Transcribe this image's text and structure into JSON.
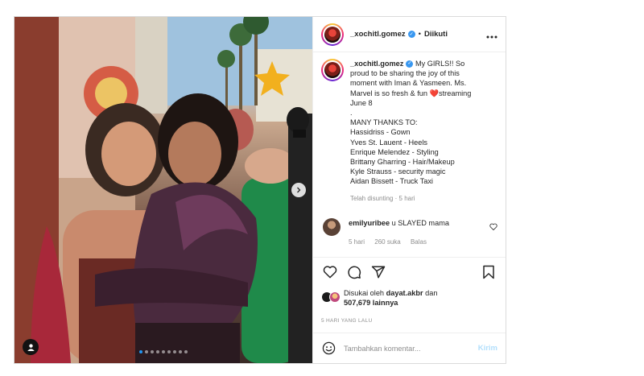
{
  "post": {
    "username": "_xochitl.gomez",
    "follow_separator": "•",
    "follow_state": "Diikuti",
    "caption_lines": [
      "My GIRLS!! So",
      "proud to be sharing the joy of this",
      "moment with Iman & Yasmeen. Ms.",
      "Marvel is so fresh & fun",
      "June 8",
      ".",
      "MANY THANKS TO:",
      "Hassidriss - Gown",
      "Yves St. Lauent - Heels",
      "Enrique Melendez - Styling",
      "Brittany Gharring - Hair/Makeup",
      "Kyle Strauss - security magic",
      "Aidan Bissett - Truck Taxi"
    ],
    "caption_emoji_text": "❤️",
    "caption_after_emoji": "streaming",
    "caption_meta_edited": "Telah disunting",
    "caption_meta_sep": "·",
    "caption_meta_time": "5 hari",
    "comment": {
      "username": "emilyuribee",
      "text": "u SLAYED mama",
      "time": "5 hari",
      "likes": "260 suka",
      "reply": "Balas"
    },
    "likes_prefix": "Disukai oleh",
    "likes_user": "dayat.akbr",
    "likes_and": "dan",
    "likes_count": "507,679 lainnya",
    "date": "5 HARI YANG LALU",
    "comment_placeholder": "Tambahkan komentar...",
    "post_button": "Kirim",
    "carousel_count": 9,
    "carousel_active": 0
  },
  "icons": {
    "more": "more-horizontal-icon",
    "like": "heart-icon",
    "comment": "comment-icon",
    "share": "share-icon",
    "save": "bookmark-icon",
    "emoji": "emoji-icon",
    "next": "chevron-right-icon",
    "user_tag": "user-tag-icon"
  },
  "colors": {
    "accent": "#3897f0",
    "post_button_disabled": "#b2dffc",
    "muted": "#8e8e8e",
    "text": "#262626"
  }
}
